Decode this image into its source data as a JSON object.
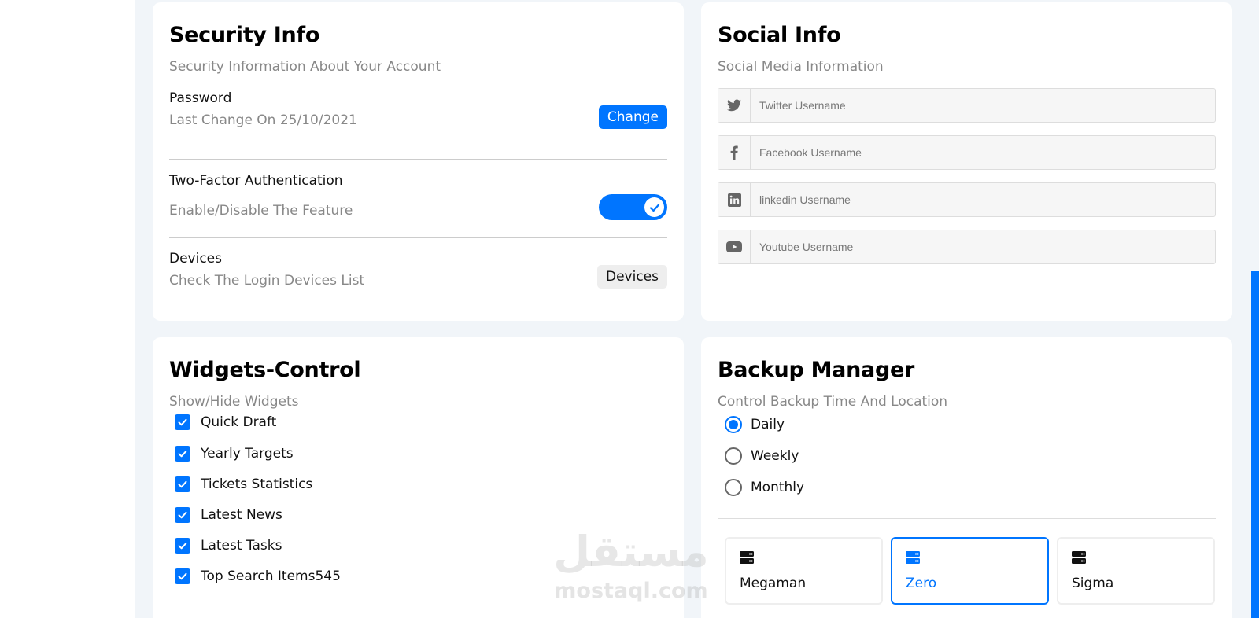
{
  "security": {
    "title": "Security Info",
    "subtitle": "Security Information About Your Account",
    "password_label": "Password",
    "password_desc": "Last Change On 25/10/2021",
    "change_button": "Change",
    "twofa_label": "Two-Factor Authentication",
    "twofa_desc": "Enable/Disable The Feature",
    "twofa_enabled": true,
    "devices_label": "Devices",
    "devices_desc": "Check The Login Devices List",
    "devices_button": "Devices"
  },
  "social": {
    "title": "Social Info",
    "subtitle": "Social Media Information",
    "fields": [
      {
        "icon": "twitter-icon",
        "placeholder": "Twitter Username"
      },
      {
        "icon": "facebook-icon",
        "placeholder": "Facebook Username"
      },
      {
        "icon": "linkedin-icon",
        "placeholder": "linkedin Username"
      },
      {
        "icon": "youtube-icon",
        "placeholder": "Youtube Username"
      }
    ]
  },
  "widgets": {
    "title": "Widgets-Control",
    "subtitle": "Show/Hide Widgets",
    "items": [
      {
        "label": "Quick Draft",
        "checked": true
      },
      {
        "label": "Yearly Targets",
        "checked": true
      },
      {
        "label": "Tickets Statistics",
        "checked": true
      },
      {
        "label": "Latest News",
        "checked": true
      },
      {
        "label": "Latest Tasks",
        "checked": true
      },
      {
        "label": "Top Search Items545",
        "checked": true
      }
    ]
  },
  "backup": {
    "title": "Backup Manager",
    "subtitle": "Control Backup Time And Location",
    "options": [
      {
        "label": "Daily",
        "checked": true
      },
      {
        "label": "Weekly",
        "checked": false
      },
      {
        "label": "Monthly",
        "checked": false
      }
    ],
    "servers": [
      {
        "name": "Megaman",
        "selected": false
      },
      {
        "name": "Zero",
        "selected": true
      },
      {
        "name": "Sigma",
        "selected": false
      }
    ]
  },
  "watermark": {
    "arabic": "مستقل",
    "latin": "mostaql.com"
  },
  "colors": {
    "accent": "#0075ff",
    "background": "#f1f5f9",
    "muted_text": "#888888"
  }
}
